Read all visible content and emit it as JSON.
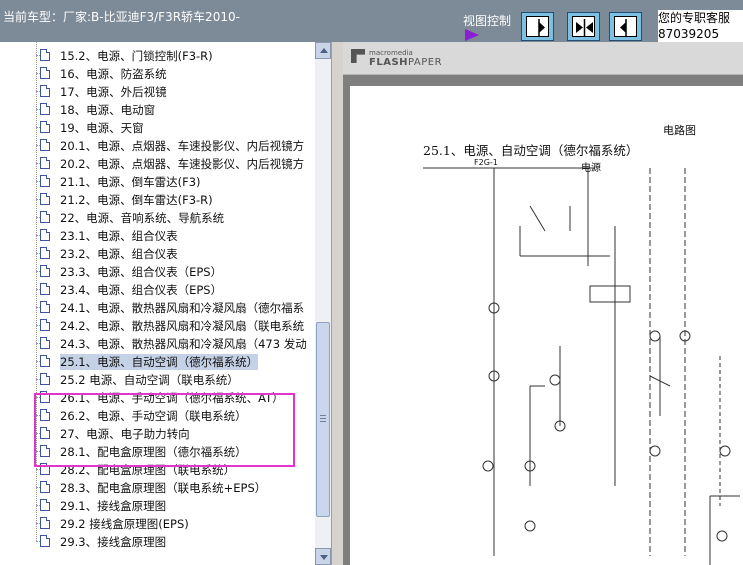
{
  "header": {
    "title": "当前车型：厂家:B-比亚迪F3/F3R轿车2010-",
    "view_control_label": "视图控制",
    "contact_line1": "您的专职客服",
    "contact_line2": "87039205"
  },
  "tree": {
    "items": [
      {
        "label": "15.2、电源、门锁控制(F3-R)"
      },
      {
        "label": "16、电源、防盗系统"
      },
      {
        "label": "17、电源、外后视镜"
      },
      {
        "label": "18、电源、电动窗"
      },
      {
        "label": "19、电源、天窗"
      },
      {
        "label": "20.1、电源、点烟器、车速投影仪、内后视镜方"
      },
      {
        "label": "20.2、电源、点烟器、车速投影仪、内后视镜方"
      },
      {
        "label": "21.1、电源、倒车雷达(F3)"
      },
      {
        "label": "21.2、电源、倒车雷达(F3-R)"
      },
      {
        "label": "22、电源、音响系统、导航系统"
      },
      {
        "label": "23.1、电源、组合仪表"
      },
      {
        "label": "23.2、电源、组合仪表"
      },
      {
        "label": "23.3、电源、组合仪表（EPS）"
      },
      {
        "label": "23.4、电源、组合仪表（EPS）"
      },
      {
        "label": "24.1、电源、散热器风扇和冷凝风扇（德尔福系"
      },
      {
        "label": "24.2、电源、散热器风扇和冷凝风扇（联电系统"
      },
      {
        "label": "24.3、电源、散热器风扇和冷凝风扇（473 发动"
      },
      {
        "label": "25.1、电源、自动空调（德尔福系统）"
      },
      {
        "label": "25.2 电源、自动空调（联电系统）"
      },
      {
        "label": "26.1、电源、手动空调（德尔福系统、AT）"
      },
      {
        "label": "26.2、电源、手动空调（联电系统）"
      },
      {
        "label": "27、电源、电子助力转向"
      },
      {
        "label": "28.1、配电盒原理图（德尔福系统）"
      },
      {
        "label": "28.2、配电盒原理图（联电系统）"
      },
      {
        "label": "28.3、配电盒原理图（联电系统+EPS）"
      },
      {
        "label": "29.1、接线盒原理图"
      },
      {
        "label": "29.2 接线盒原理图(EPS)"
      },
      {
        "label": "29.3、接线盒原理图"
      }
    ],
    "selected_index": 17,
    "highlight_color": "#e434d0"
  },
  "viewer": {
    "brand_top": "macromedia",
    "brand_main": "FLASH",
    "brand_sub": "PAPER",
    "page_header": "电路图",
    "page_title": "25.1、电源、自动空调（德尔福系统）",
    "page_label": "电源",
    "fuse_label": "F2G-1"
  },
  "colors": {
    "topbar": "#7d8a97",
    "accent_arrow": "#8a1fd6",
    "button_fill": "#7ec0e2"
  }
}
